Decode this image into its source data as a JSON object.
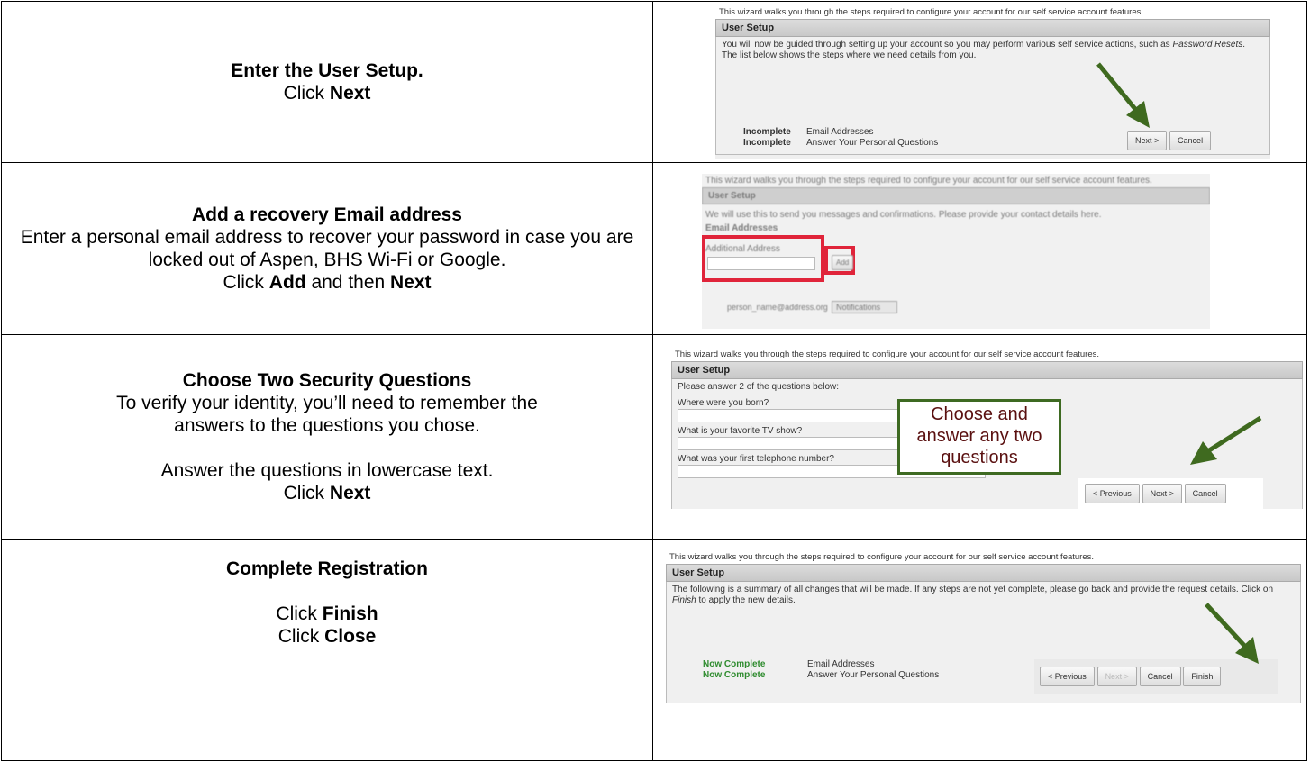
{
  "steps": [
    {
      "title": "Enter the User Setup.",
      "lines": [
        {
          "pre": "Click ",
          "bold": "Next",
          "mid": "",
          "bold2": ""
        }
      ],
      "shot": {
        "intro": "This wizard walks you through the steps required to configure your account for our self service account features.",
        "header": "User Setup",
        "body1": "You will now be guided through setting up your account so you may perform various self service actions, such as",
        "body1_italic": "Password Resets",
        "body2": "The list below shows the steps where we need details from you.",
        "rows": [
          {
            "status": "Incomplete",
            "item": "Email Addresses"
          },
          {
            "status": "Incomplete",
            "item": "Answer Your Personal Questions"
          }
        ],
        "buttons": [
          "Next >",
          "Cancel"
        ]
      }
    },
    {
      "title": "Add a recovery Email address",
      "body": "Enter a personal email address to recover your password in case you are locked out of Aspen, BHS Wi-Fi or Google.",
      "lines": [
        {
          "pre": "Click ",
          "bold": "Add",
          "mid": " and then ",
          "bold2": "Next"
        }
      ],
      "shot": {
        "intro": "This wizard walks you through the steps required to configure your account for our self service account features.",
        "header": "User Setup",
        "body1": "We will use this to send you messages and confirmations. Please provide your contact details here.",
        "section": "Email Addresses",
        "field_label": "Additional Address",
        "add_button": "Add",
        "email_value": "person_name@address.org",
        "select_value": "Notifications"
      }
    },
    {
      "title": "Choose Two Security Questions",
      "body": "To verify your identity, you’ll need to remember the answers to the questions you chose.",
      "body2": "Answer the questions in lowercase text.",
      "lines": [
        {
          "pre": "Click ",
          "bold": "Next",
          "mid": "",
          "bold2": ""
        }
      ],
      "shot": {
        "intro": "This wizard walks you through the steps required to configure your account for our self service account features.",
        "header": "User Setup",
        "prompt": "Please answer 2 of the questions below:",
        "questions": [
          "Where were you born?",
          "What is your favorite TV show?",
          "What was your first telephone number?"
        ],
        "callout": "Choose and answer any two questions",
        "buttons": [
          "< Previous",
          "Next >",
          "Cancel"
        ]
      }
    },
    {
      "title": "Complete Registration",
      "lines": [
        {
          "pre": "Click ",
          "bold": "Finish",
          "mid": "",
          "bold2": ""
        },
        {
          "pre": "Click ",
          "bold": "Close",
          "mid": "",
          "bold2": ""
        }
      ],
      "shot": {
        "intro": "This wizard walks you through the steps required to configure your account for our self service account features.",
        "header": "User Setup",
        "body1": "The following is a summary of all changes that will be made. If any steps are not yet complete, please go back and provide the request details. Click on",
        "body1_italic": "Finish",
        "body1_end": "to apply the new details.",
        "rows": [
          {
            "status": "Now Complete",
            "item": "Email Addresses"
          },
          {
            "status": "Now Complete",
            "item": "Answer Your Personal Questions"
          }
        ],
        "buttons": [
          "< Previous",
          "Next >",
          "Cancel",
          "Finish"
        ]
      }
    }
  ],
  "colors": {
    "arrow": "#3f6a1f",
    "highlight": "#e0243a",
    "complete": "#2e8b2e",
    "callout_border": "#3e6a22",
    "callout_text": "#5a1010"
  }
}
